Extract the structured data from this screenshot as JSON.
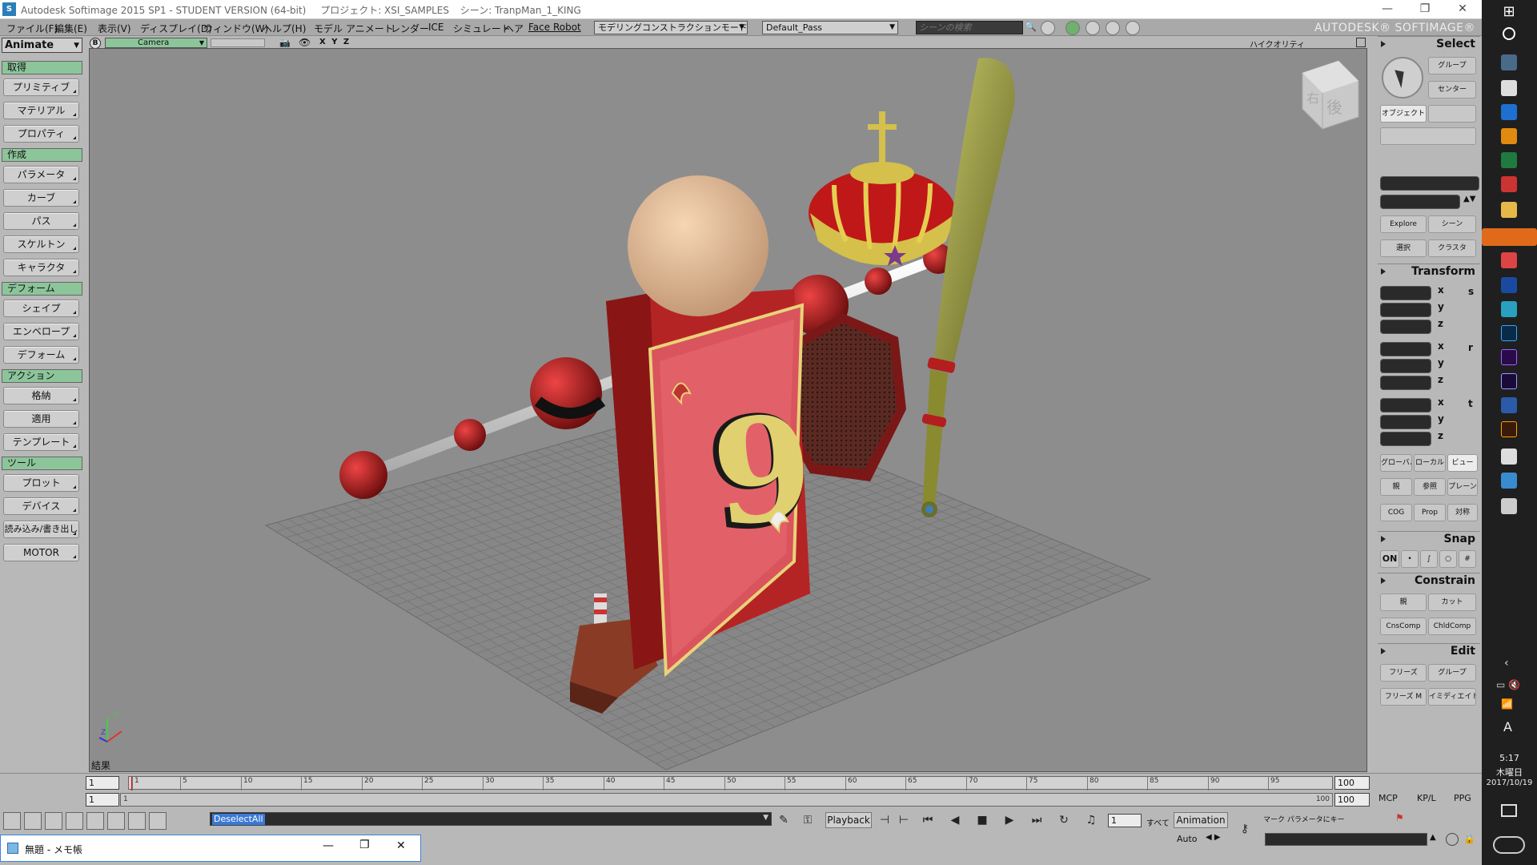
{
  "titlebar": {
    "app_title": "Autodesk Softimage 2015 SP1 - STUDENT VERSION (64-bit)",
    "project": "プロジェクト: XSI_SAMPLES",
    "scene": "シーン: TranpMan_1_KING",
    "minimize": "—",
    "restore": "❐",
    "close": "✕"
  },
  "menubar": {
    "items": [
      "ファイル(F)",
      "編集(E)",
      "表示(V)",
      "ディスプレイ(D)",
      "ウィンドウ(W)",
      "ヘルプ(H)",
      "モデル",
      "アニメート",
      "レンダー",
      "ICE",
      "シミュレート",
      "ヘア",
      "Face Robot"
    ],
    "construction_mode": "モデリングコンストラクションモード",
    "pass": "Default_Pass",
    "scene_search_placeholder": "シーンの検索",
    "brand": "AUTODESK® SOFTIMAGE®"
  },
  "leftpanel": {
    "mode": "Animate",
    "sections": [
      {
        "title": "取得",
        "buttons": [
          "プリミティブ",
          "マテリアル",
          "プロパティ"
        ]
      },
      {
        "title": "作成",
        "buttons": [
          "パラメータ",
          "カーブ",
          "パス",
          "スケルトン",
          "キャラクタ"
        ]
      },
      {
        "title": "デフォーム",
        "buttons": [
          "シェイプ",
          "エンベロープ",
          "デフォーム"
        ]
      },
      {
        "title": "アクション",
        "buttons": [
          "格納",
          "適用",
          "テンプレート"
        ]
      },
      {
        "title": "ツール",
        "buttons": [
          "プロット",
          "デバイス",
          "読み込み/書き出し",
          "MOTOR"
        ]
      }
    ]
  },
  "viewport": {
    "badge": "B",
    "camera": "Camera",
    "axes_label": "X Y Z",
    "quality": "ハイクオリティ",
    "status": "結果",
    "navcube_face1": "右",
    "navcube_face2": "後",
    "card_number": "9"
  },
  "rightpanel": {
    "select_title": "Select",
    "group": "グループ",
    "center": "センター",
    "object": "オブジェクト",
    "explore": "Explore",
    "scene": "シーン",
    "selection": "選択",
    "cluster": "クラスタ",
    "transform_title": "Transform",
    "axes": [
      "x",
      "y",
      "z"
    ],
    "transform_icons": [
      "s",
      "r",
      "t"
    ],
    "global": "グローバル",
    "local": "ローカル",
    "view": "ビュー",
    "parent": "親",
    "ref": "参照",
    "plane": "プレーン",
    "cog": "COG",
    "prop": "Prop",
    "sym": "対称",
    "snap_title": "Snap",
    "snap_on": "ON",
    "constrain_title": "Constrain",
    "parent2": "親",
    "cut": "カット",
    "cnscomp": "CnsComp",
    "chldcomp": "ChldComp",
    "edit_title": "Edit",
    "freeze": "フリーズ",
    "group2": "グループ",
    "freeze_m": "フリーズ M",
    "immediate": "イミディエイト",
    "tabs": [
      "MCP",
      "KP/L",
      "PPG"
    ]
  },
  "timeline": {
    "start": "1",
    "end": "100",
    "range_start": "1",
    "range_label": "1",
    "range_end": "100",
    "range_end2": "100",
    "ticks": [
      "1",
      "5",
      "10",
      "15",
      "20",
      "25",
      "30",
      "35",
      "40",
      "45",
      "50",
      "55",
      "60",
      "65",
      "70",
      "75",
      "80",
      "85",
      "90",
      "95"
    ],
    "command": "DeselectAll",
    "playback": "Playback",
    "frame": "1",
    "all": "すべて",
    "animation": "Animation",
    "auto": "Auto",
    "mark_label": "マーク パラメータにキー"
  },
  "notepad": {
    "title": "無題 - メモ帳"
  },
  "taskbar": {
    "lang": "A",
    "time": "5:17",
    "day": "木曜日",
    "date": "2017/10/19"
  },
  "colors": {
    "section_green": "#8cc59a",
    "viewport_bg": "#8d8d8d",
    "accent_blue": "#3b79d6"
  }
}
